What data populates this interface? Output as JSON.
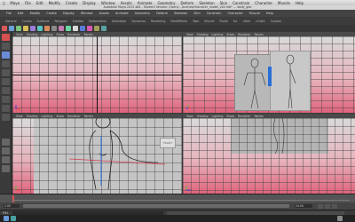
{
  "os_menu": {
    "apple": "",
    "items": [
      "Maya",
      "File",
      "Edit",
      "Modify",
      "Create",
      "Display",
      "Window",
      "Assets",
      "Animate",
      "Geometry",
      "Deform",
      "Skeleton",
      "Skin",
      "Constrain",
      "Character",
      "Muscle",
      "Help"
    ]
  },
  "window_title": "Autodesk Maya 2013 x64 - Student Version: /Users/.../scenes/character_model_v02.mb* --- body_geo",
  "main_menus": [
    "File",
    "Edit",
    "Modify",
    "Create",
    "Display",
    "Window",
    "Assets",
    "Animate",
    "Geometry",
    "Deform",
    "Skeleton",
    "Skin",
    "Constrain",
    "Character",
    "Muscle",
    "Help"
  ],
  "shelf_tabs": [
    "General",
    "Curves",
    "Surfaces",
    "Polygons",
    "Subdivs",
    "Deformation",
    "Animation",
    "Dynamics",
    "Rendering",
    "PaintEffects",
    "Toon",
    "Muscle",
    "Fluids",
    "Fur",
    "nHair",
    "nCloth",
    "Custom"
  ],
  "panel_menu": [
    "View",
    "Shading",
    "Lighting",
    "Show",
    "Renderer",
    "Panels"
  ],
  "front_label": "FRONT",
  "range": {
    "start": "1.00",
    "end": "24.00"
  },
  "command_line": {
    "label": "MEL"
  }
}
